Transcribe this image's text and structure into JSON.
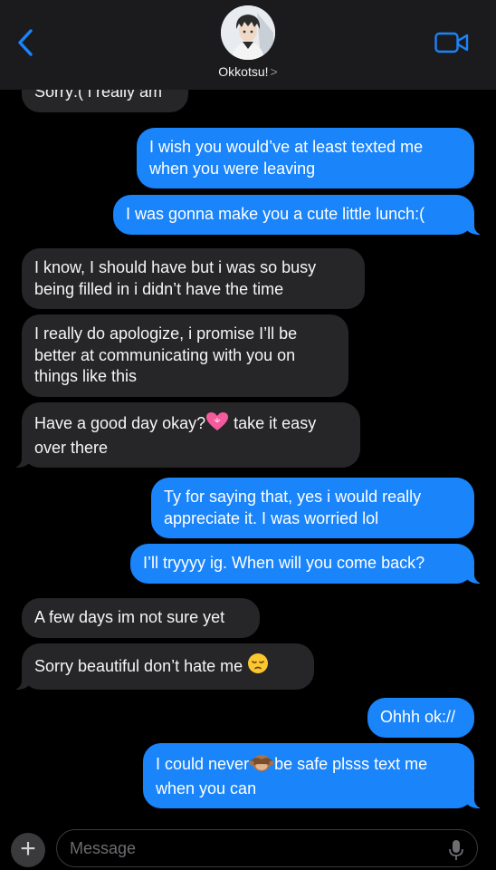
{
  "header": {
    "contact_name": "Okkotsu!",
    "chevron": ">",
    "back_icon": "chevron-left-icon",
    "video_icon": "video-camera-icon",
    "accent_color": "#1a84fb"
  },
  "messages": [
    {
      "from": "contact",
      "text": "Sorry:( i really am"
    },
    {
      "from": "me",
      "text": "I wish you would’ve at least texted me when you were leaving"
    },
    {
      "from": "me",
      "text": "I was gonna make you a cute little lunch:("
    },
    {
      "from": "contact",
      "text": "I know, I should have but i was so busy being filled in i didn’t have the time"
    },
    {
      "from": "contact",
      "text": "I really do apologize, i promise I’ll be better at communicating with you on things like this"
    },
    {
      "from": "contact",
      "text_before": "Have a good day okay?",
      "emoji": "pink-heart-icon",
      "text_after": " take it easy over there"
    },
    {
      "from": "me",
      "text": "Ty for saying that, yes i would really appreciate it. I was worried lol"
    },
    {
      "from": "me",
      "text": "I’ll tryyyy ig. When will you come back?"
    },
    {
      "from": "contact",
      "text": "A few days im not sure yet"
    },
    {
      "from": "contact",
      "text_before": "Sorry beautiful don’t hate me ",
      "emoji": "pensive-face-icon"
    },
    {
      "from": "me",
      "text": "Ohhh ok://"
    },
    {
      "from": "me",
      "text_before": "I could never",
      "emoji": "see-no-evil-monkey-icon",
      "text_after": "be safe plsss text me when you can"
    }
  ],
  "composer": {
    "placeholder": "Message",
    "plus_label": "+",
    "plus_icon": "plus-icon",
    "mic_icon": "microphone-icon"
  }
}
